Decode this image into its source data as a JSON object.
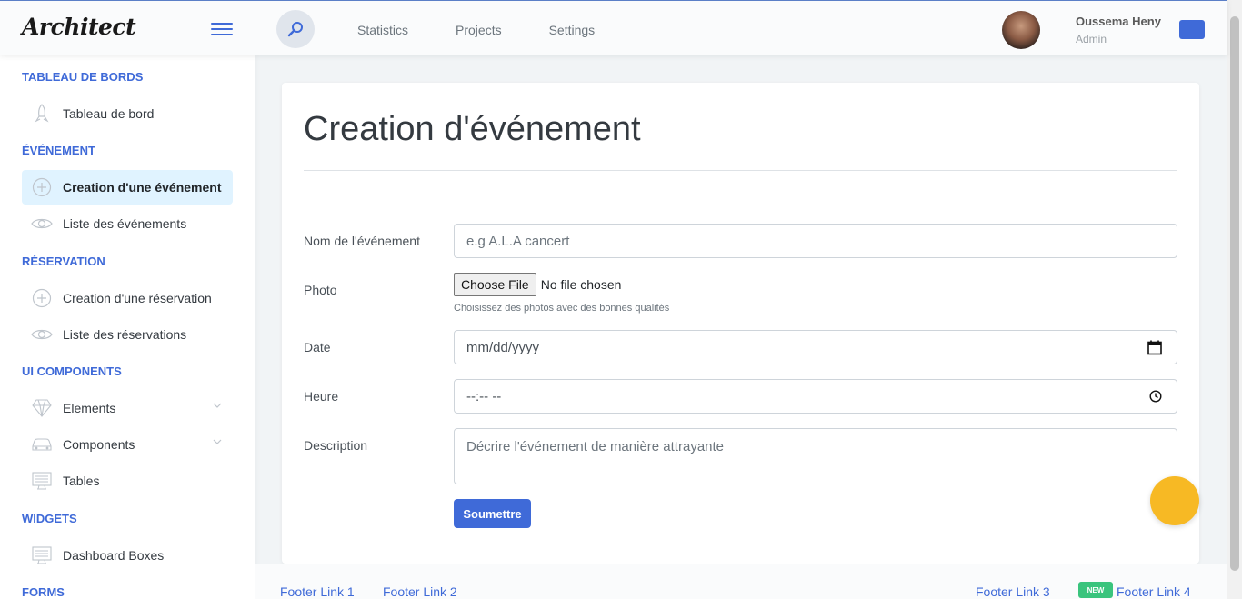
{
  "header": {
    "logo": "Architect",
    "nav": [
      "Statistics",
      "Projects",
      "Settings"
    ],
    "user": {
      "name": "Oussema Heny",
      "role": "Admin"
    }
  },
  "sidebar": {
    "sections": [
      {
        "title": "TABLEAU DE BORDS"
      },
      {
        "title": "ÉVÉNEMENT"
      },
      {
        "title": "RÉSERVATION"
      },
      {
        "title": "UI COMPONENTS"
      },
      {
        "title": "WIDGETS"
      },
      {
        "title": "FORMS"
      }
    ],
    "items": [
      {
        "label": "Tableau de bord",
        "icon": "rocket-icon"
      },
      {
        "label": "Creation d'une événement",
        "icon": "plus-circle-icon"
      },
      {
        "label": "Liste des événements",
        "icon": "eye-icon"
      },
      {
        "label": "Creation d'une réservation",
        "icon": "plus-circle-icon"
      },
      {
        "label": "Liste des réservations",
        "icon": "eye-icon"
      },
      {
        "label": "Elements",
        "icon": "diamond-icon"
      },
      {
        "label": "Components",
        "icon": "car-icon"
      },
      {
        "label": "Tables",
        "icon": "monitor-icon"
      },
      {
        "label": "Dashboard Boxes",
        "icon": "monitor-icon"
      }
    ]
  },
  "form": {
    "title": "Creation d'événement",
    "name_label": "Nom de l'événement",
    "name_placeholder": "e.g A.L.A cancert",
    "photo_label": "Photo",
    "file_button": "Choose File",
    "file_status": "No file chosen",
    "file_help": "Choisissez des photos avec des bonnes qualités",
    "date_label": "Date",
    "date_placeholder": "mm/dd/yyyy",
    "time_label": "Heure",
    "time_placeholder": "--:-- --",
    "desc_label": "Description",
    "desc_placeholder": "Décrire l'événement de manière attrayante",
    "submit": "Soumettre"
  },
  "footer": {
    "links": [
      "Footer Link 1",
      "Footer Link 2",
      "Footer Link 3",
      "Footer Link 4"
    ],
    "badge": "NEW"
  },
  "colors": {
    "primary": "#3f6ad8",
    "warning": "#f7b924",
    "success": "#3ac47d"
  }
}
